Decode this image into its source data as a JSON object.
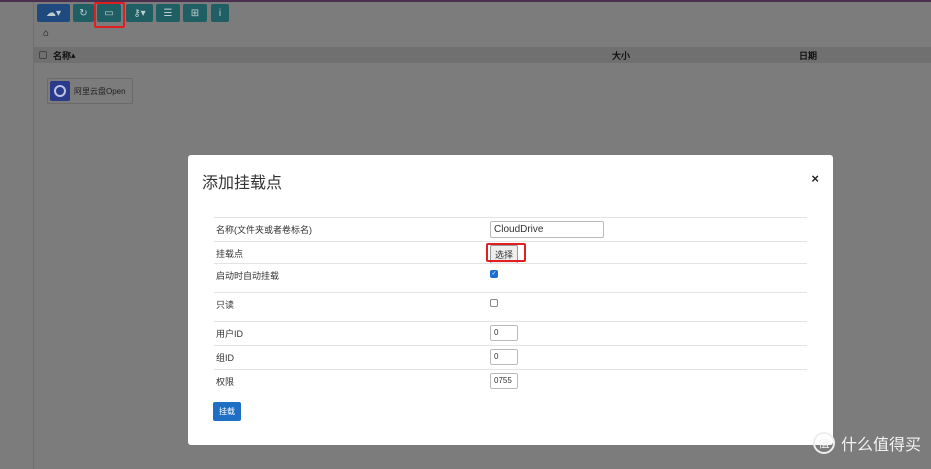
{
  "toolbar": {
    "buttons": [
      "cloud-icon",
      "refresh-icon",
      "monitor-icon",
      "key-icon",
      "list-icon",
      "tree-icon",
      "info-icon"
    ]
  },
  "breadcrumb": {
    "home": "⌂"
  },
  "table": {
    "col_name": "名称",
    "col_size": "大小",
    "col_date": "日期"
  },
  "items": [
    {
      "label": "阿里云盘Open"
    }
  ],
  "modal": {
    "title": "添加挂载点",
    "close": "×",
    "fields": {
      "name_label": "名称(文件夹或者卷标名)",
      "name_value": "CloudDrive",
      "mount_label": "挂载点",
      "mount_button": "选择",
      "auto_label": "启动时自动挂载",
      "auto_checked": true,
      "readonly_label": "只读",
      "readonly_checked": false,
      "uid_label": "用户ID",
      "uid_value": "0",
      "gid_label": "组ID",
      "gid_value": "0",
      "perm_label": "权限",
      "perm_value": "0755"
    },
    "submit": "挂载"
  },
  "watermark": {
    "logo": "值",
    "text": "什么值得买"
  }
}
